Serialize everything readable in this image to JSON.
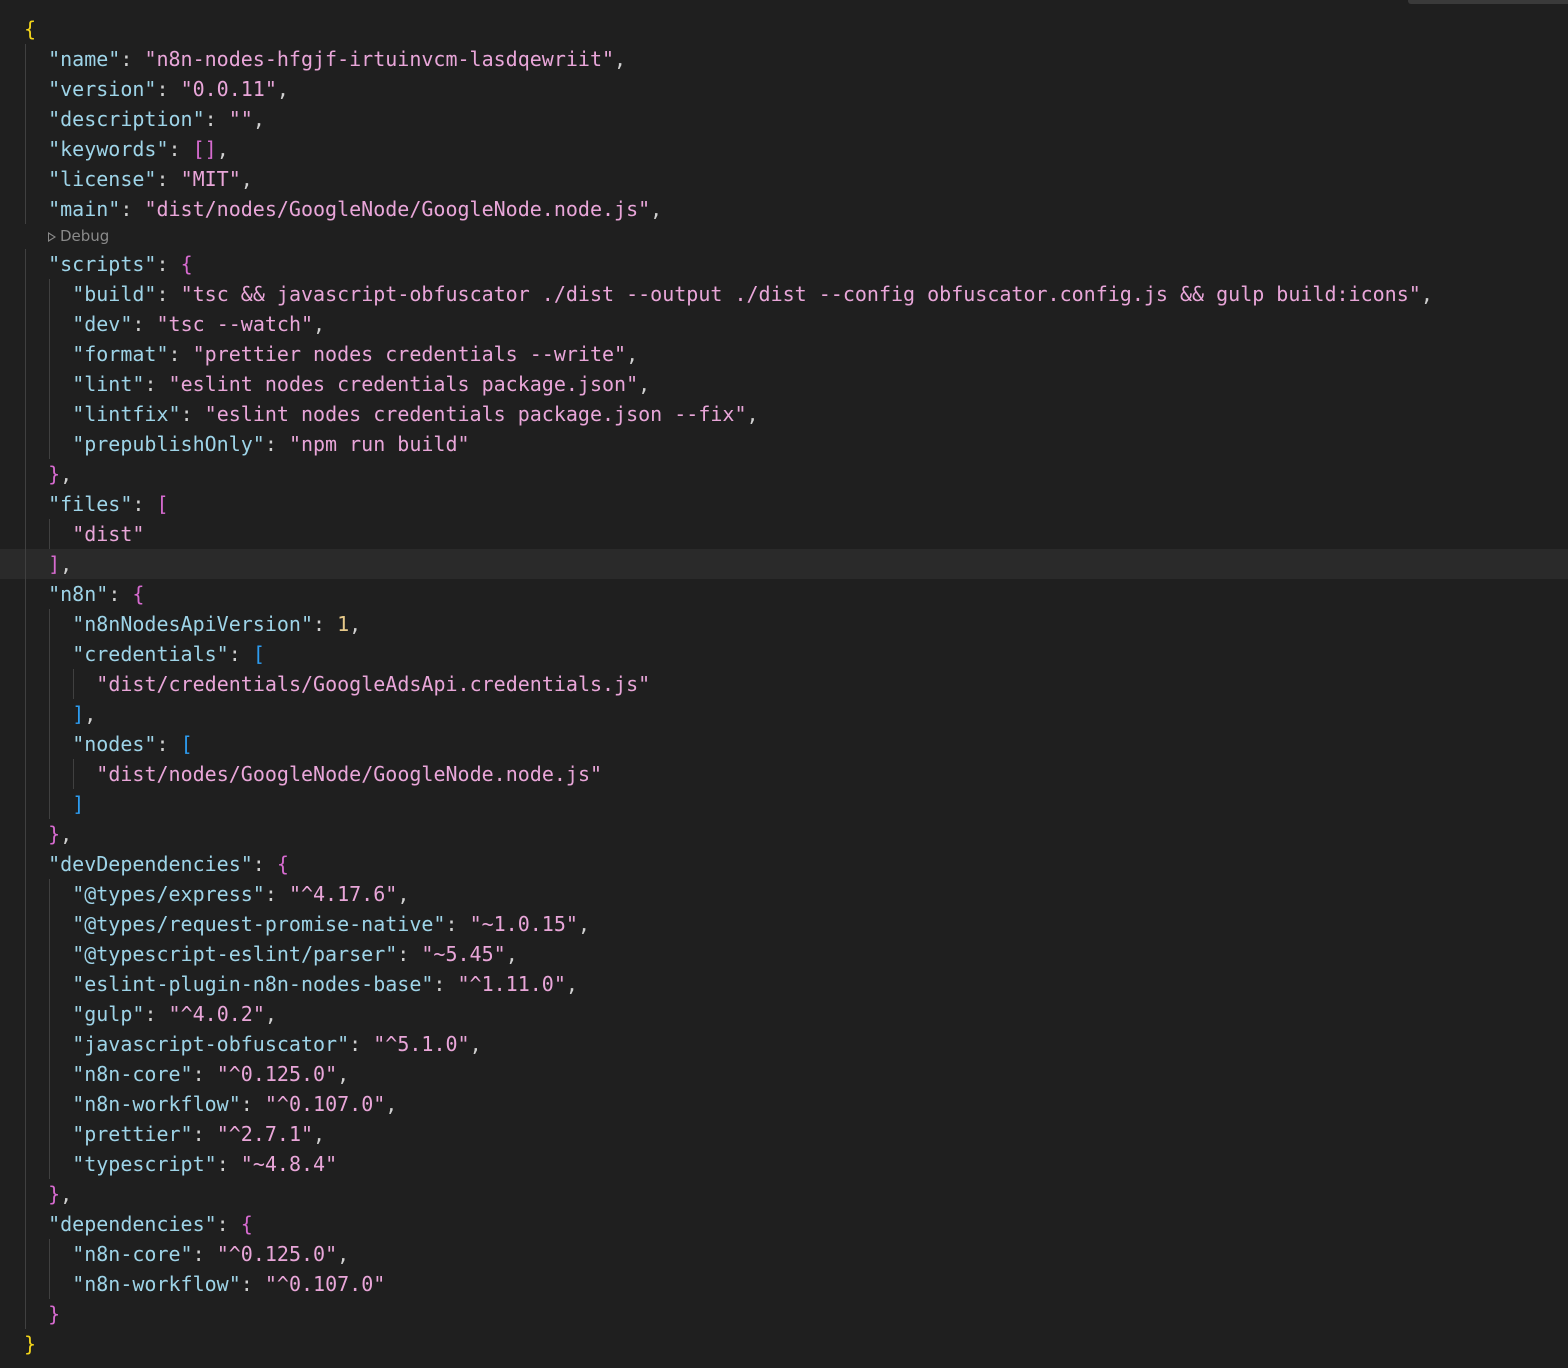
{
  "editor": {
    "codelens_debug": "Debug",
    "lines": [
      "{",
      "\"name\": \"n8n-nodes-hfgjf-irtuinvcm-lasdqewriit\",",
      "\"version\": \"0.0.11\",",
      "\"description\": \"\",",
      "\"keywords\": [],",
      "\"license\": \"MIT\",",
      "\"main\": \"dist/nodes/GoogleNode/GoogleNode.node.js\",",
      "\"scripts\": {",
      "\"build\": \"tsc && javascript-obfuscator ./dist --output ./dist --config obfuscator.config.js && gulp build:icons\",",
      "\"dev\": \"tsc --watch\",",
      "\"format\": \"prettier nodes credentials --write\",",
      "\"lint\": \"eslint nodes credentials package.json\",",
      "\"lintfix\": \"eslint nodes credentials package.json --fix\",",
      "\"prepublishOnly\": \"npm run build\"",
      "},",
      "\"files\": [",
      "\"dist\"",
      "],",
      "\"n8n\": {",
      "\"n8nNodesApiVersion\": 1,",
      "\"credentials\": [",
      "\"dist/credentials/GoogleAdsApi.credentials.js\"",
      "],",
      "\"nodes\": [",
      "\"dist/nodes/GoogleNode/GoogleNode.node.js\"",
      "]",
      "},",
      "\"devDependencies\": {",
      "\"@types/express\": \"^4.17.6\",",
      "\"@types/request-promise-native\": \"~1.0.15\",",
      "\"@typescript-eslint/parser\": \"~5.45\",",
      "\"eslint-plugin-n8n-nodes-base\": \"^1.11.0\",",
      "\"gulp\": \"^4.0.2\",",
      "\"javascript-obfuscator\": \"^5.1.0\",",
      "\"n8n-core\": \"^0.125.0\",",
      "\"n8n-workflow\": \"^0.107.0\",",
      "\"prettier\": \"^2.7.1\",",
      "\"typescript\": \"~4.8.4\"",
      "},",
      "\"dependencies\": {",
      "\"n8n-core\": \"^0.125.0\",",
      "\"n8n-workflow\": \"^0.107.0\"",
      "}",
      "}"
    ]
  }
}
